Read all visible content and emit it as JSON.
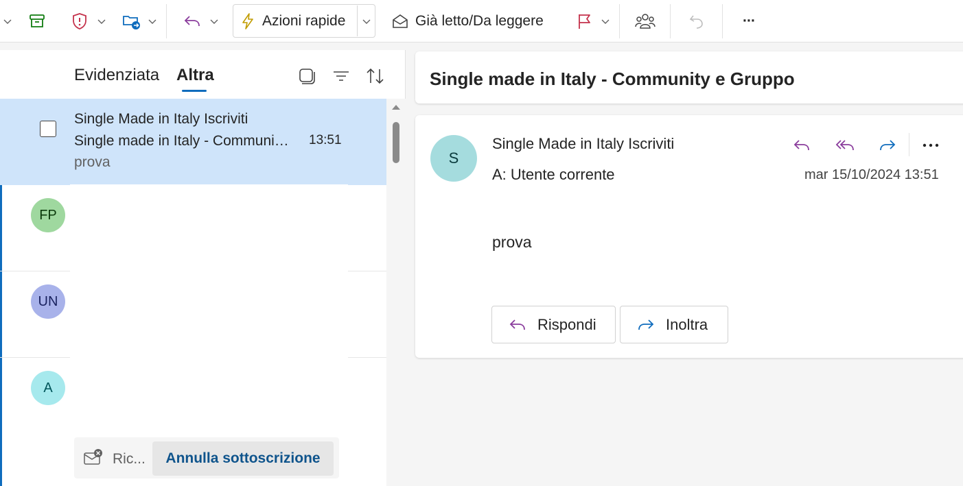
{
  "toolbar": {
    "quick_actions_label": "Azioni rapide",
    "read_unread_label": "Già letto/Da leggere",
    "more_label": "···"
  },
  "list": {
    "tabs": [
      {
        "label": "Evidenziata",
        "active": false
      },
      {
        "label": "Altra",
        "active": true
      }
    ],
    "selected_message": {
      "sender": "Single Made in Italy Iscriviti",
      "subject": "Single made in Italy - Community e Gruppo",
      "time": "13:51",
      "preview": "prova"
    },
    "other_messages": [
      {
        "initials": "FP",
        "avatar_bg": "#9fd89f",
        "avatar_fg": "#0b3a0b"
      },
      {
        "initials": "UN",
        "avatar_bg": "#a8b2ea",
        "avatar_fg": "#1a2360"
      },
      {
        "initials": "A",
        "avatar_bg": "#a6e9ed",
        "avatar_fg": "#00555a"
      }
    ],
    "unsubscribe": {
      "small_text": "Ric...",
      "button_label": "Annulla sottoscrizione"
    }
  },
  "reading": {
    "subject": "Single made in Italy - Community e Gruppo",
    "avatar_initial": "S",
    "avatar_bg": "#a5dcde",
    "from": "Single Made in Italy Iscriviti",
    "to": "A:  Utente corrente",
    "date": "mar 15/10/2024 13:51",
    "body": "prova",
    "reply_label": "Rispondi",
    "forward_label": "Inoltra"
  },
  "colors": {
    "accent": "#0f6cbd",
    "selected_row": "#cfe4fa",
    "reply_purple": "#8a3c9c",
    "forward_blue": "#0f6cbd",
    "flag_red": "#c4314b",
    "archive_green": "#107c10"
  }
}
